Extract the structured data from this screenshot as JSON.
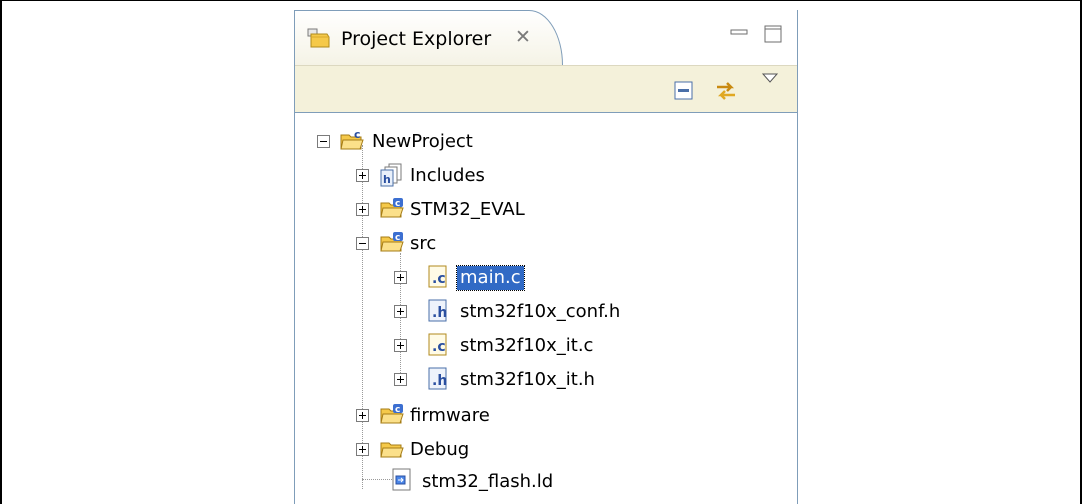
{
  "tab": {
    "title": "Project Explorer",
    "close_glyph": "✕"
  },
  "colors": {
    "selection": "#316ac5",
    "toolbar_bg": "#f4f1da",
    "panel_border": "#7f9db9"
  },
  "tree": {
    "root": {
      "label": "NewProject",
      "icon": "c-project-icon",
      "expanded": true
    },
    "items": [
      {
        "label": "Includes",
        "icon": "includes-icon",
        "expanded": false
      },
      {
        "label": "STM32_EVAL",
        "icon": "source-folder-icon",
        "expanded": false
      },
      {
        "label": "src",
        "icon": "source-folder-icon",
        "expanded": true
      },
      {
        "label": "main.c",
        "icon": "c-file-icon",
        "expanded": false,
        "selected": true
      },
      {
        "label": "stm32f10x_conf.h",
        "icon": "h-file-icon",
        "expanded": false
      },
      {
        "label": "stm32f10x_it.c",
        "icon": "c-file-icon",
        "expanded": false
      },
      {
        "label": "stm32f10x_it.h",
        "icon": "h-file-icon",
        "expanded": false
      },
      {
        "label": "firmware",
        "icon": "source-folder-icon",
        "expanded": false
      },
      {
        "label": "Debug",
        "icon": "folder-icon",
        "expanded": false
      },
      {
        "label": "stm32_flash.ld",
        "icon": "linker-file-icon"
      }
    ]
  }
}
